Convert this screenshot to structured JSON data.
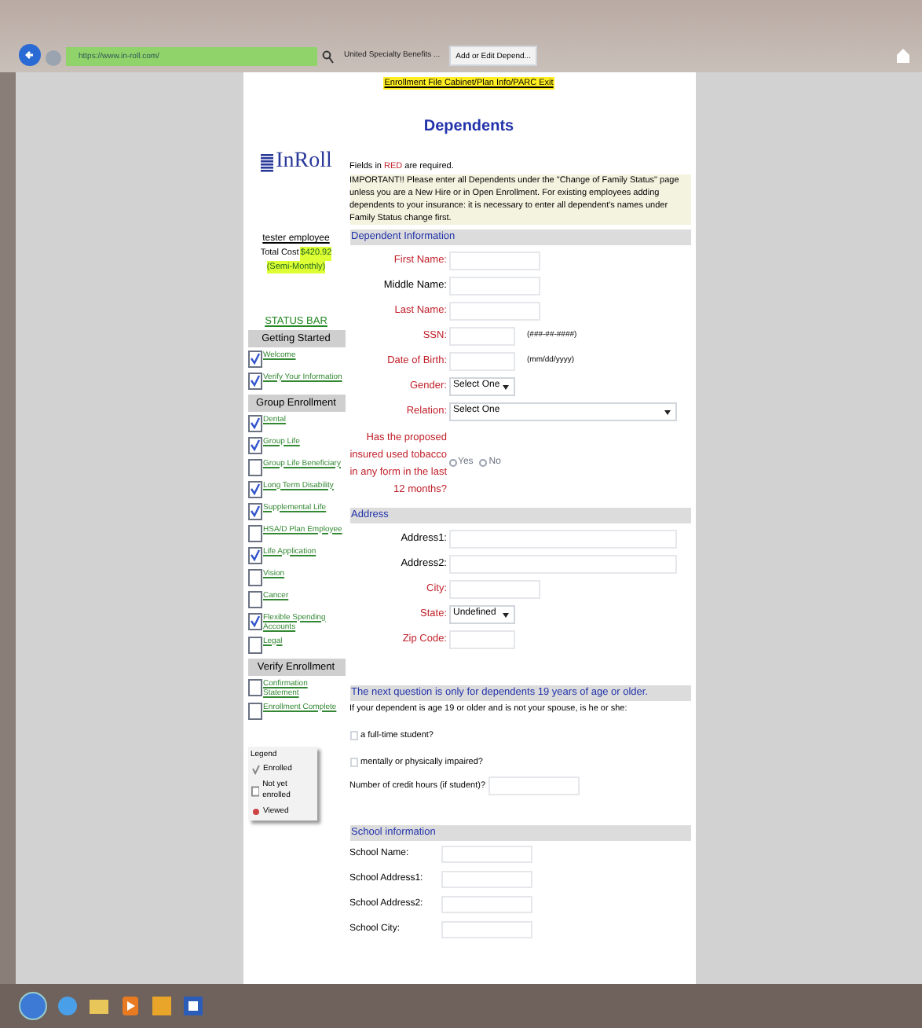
{
  "browser": {
    "url": "https://www.in-roll.com/",
    "tabs": [
      {
        "label": "United Specialty Benefits ...",
        "selected": false
      },
      {
        "label": "Add or Edit Depend...",
        "selected": true
      }
    ]
  },
  "page": {
    "top_link": "Enrollment File Cabinet/Plan Info/PARC Exit",
    "title": "Dependents",
    "logo": "InRoll",
    "note_prefix": "Fields in",
    "note_highlight": "RED",
    "note_suffix": "are required.",
    "important": "IMPORTANT!! Please enter all Dependents under the \"Change of Family Status\" page unless you are a New Hire or in Open Enrollment. For existing employees adding dependents to your insurance: it is necessary to enter all dependent's names under Family Status change first."
  },
  "sidebar": {
    "user": "tester employee",
    "cost_label": "Total Cost",
    "cost": "$420.92",
    "period": "(Semi-Monthly)",
    "status_bar": "STATUS BAR",
    "sections": [
      {
        "title": "Getting Started",
        "items": [
          {
            "label": "Welcome",
            "checked": true
          },
          {
            "label": "Verify Your Information",
            "checked": true
          }
        ]
      },
      {
        "title": "Group Enrollment",
        "items": [
          {
            "label": "Dental",
            "checked": true
          },
          {
            "label": "Group Life",
            "checked": true
          },
          {
            "label": "Group Life Beneficiary",
            "checked": false
          },
          {
            "label": "Long Term Disability",
            "checked": true
          },
          {
            "label": "Supplemental Life",
            "checked": true
          },
          {
            "label": "HSA/D Plan Employee",
            "checked": false
          },
          {
            "label": "Life Application",
            "checked": true
          },
          {
            "label": "Vision",
            "checked": false
          },
          {
            "label": "Cancer",
            "checked": false
          },
          {
            "label": "Flexible Spending Accounts",
            "checked": true
          },
          {
            "label": "Legal",
            "checked": false
          }
        ]
      },
      {
        "title": "Verify Enrollment",
        "items": [
          {
            "label": "Confirmation Statement",
            "checked": false
          },
          {
            "label": "Enrollment Complete",
            "checked": false
          }
        ]
      }
    ],
    "legend": {
      "title": "Legend",
      "items": [
        {
          "kind": "checked",
          "label": "Enrolled"
        },
        {
          "kind": "empty",
          "label": "Not yet enrolled"
        },
        {
          "kind": "viewed",
          "label": "Viewed"
        }
      ]
    }
  },
  "form": {
    "sections": [
      {
        "title": "Dependent Information",
        "fields": [
          {
            "kind": "text",
            "label": "First Name:",
            "required": true
          },
          {
            "kind": "text",
            "label": "Middle Name:",
            "required": false
          },
          {
            "kind": "text",
            "label": "Last Name:",
            "required": true
          },
          {
            "kind": "short_text",
            "label": "SSN:",
            "required": true,
            "hint": "(###-##-####)"
          },
          {
            "kind": "short_text",
            "label": "Date of Birth:",
            "required": true,
            "hint": "(mm/dd/yyyy)"
          },
          {
            "kind": "select",
            "label": "Gender:",
            "required": true,
            "value": "Select One"
          },
          {
            "kind": "long_select",
            "label": "Relation:",
            "required": true,
            "value": "Select One"
          },
          {
            "kind": "radio",
            "label": "Has the proposed insured used tobacco in any form in the last 12 months?",
            "required": true,
            "options": [
              {
                "label": "Yes",
                "selected": false
              },
              {
                "label": "No",
                "selected": false
              }
            ]
          }
        ]
      },
      {
        "title": "Address",
        "fields": [
          {
            "kind": "long_text",
            "label": "Address1:",
            "required": false
          },
          {
            "kind": "long_text",
            "label": "Address2:",
            "required": false
          },
          {
            "kind": "text",
            "label": "City:",
            "required": true
          },
          {
            "kind": "select",
            "label": "State:",
            "required": true,
            "value": "Undefined"
          },
          {
            "kind": "short_text",
            "label": "Zip Code:",
            "required": true
          }
        ]
      }
    ],
    "age_section": {
      "title": "The next question is only for dependents 19 years of age or older.",
      "intro": "If your dependent is age 19 or older and is not your spouse, is he or she:",
      "checks": [
        {
          "label": "a full-time student?",
          "checked": false
        },
        {
          "label": "mentally or physically impaired?",
          "checked": false
        }
      ],
      "credit_hours": "Number of credit hours (if student)?"
    },
    "school": {
      "title": "School information",
      "fields": [
        "School Name:",
        "School Address1:",
        "School Address2:",
        "School City:"
      ]
    }
  }
}
